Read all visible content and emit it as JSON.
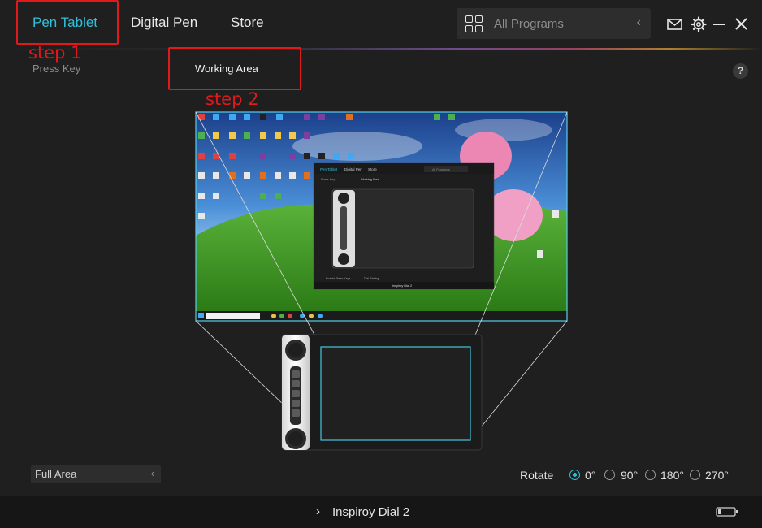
{
  "nav": {
    "tabs": [
      {
        "label": "Pen Tablet",
        "active": true
      },
      {
        "label": "Digital Pen",
        "active": false
      },
      {
        "label": "Store",
        "active": false
      }
    ],
    "program_select": {
      "value": "All Programs"
    }
  },
  "annotations": {
    "step1": "step 1",
    "step2": "step 2"
  },
  "subnav": {
    "press_key": "Press Key",
    "working_area": "Working Area",
    "help": "?"
  },
  "preview": {
    "mini_tabs": [
      "Pen Tablet",
      "Digital Pen",
      "Store"
    ],
    "mini_programs": "All Programs",
    "mini_press_key": "Press Key",
    "mini_working_area": "Working Area",
    "mini_enable": "Enable Press Keys",
    "mini_dial": "Dial Setting",
    "mini_device": "Inspiroy Dial 2"
  },
  "area_select": {
    "value": "Full Area"
  },
  "rotate": {
    "label": "Rotate",
    "options": [
      "0°",
      "90°",
      "180°",
      "270°"
    ],
    "selected": "0°"
  },
  "footer": {
    "device": "Inspiroy Dial 2"
  },
  "colors": {
    "accent": "#2ec0d9",
    "annotation": "#e0191b",
    "background": "#1f1f1f"
  }
}
